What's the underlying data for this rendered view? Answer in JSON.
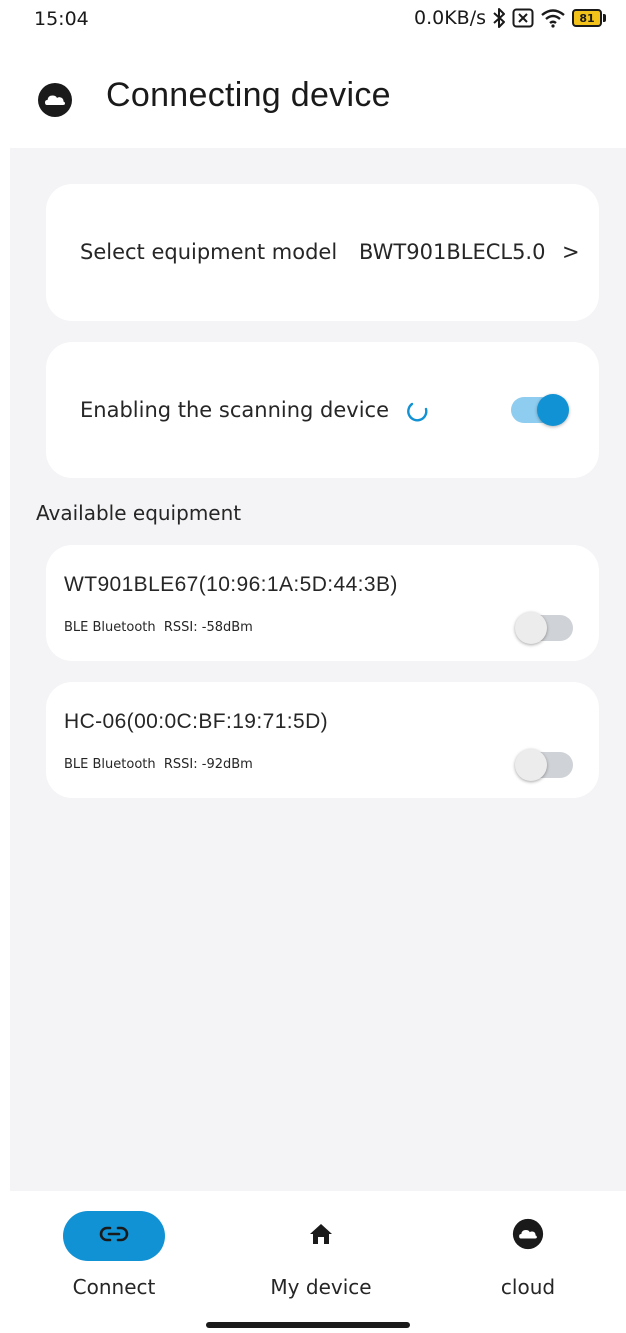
{
  "status_bar": {
    "time": "15:04",
    "network_speed": "0.0KB/s",
    "battery_level": "81",
    "icons": [
      "bluetooth-icon",
      "sim-blocked-icon",
      "wifi-icon",
      "battery-icon"
    ]
  },
  "header": {
    "title": "Connecting device",
    "icon": "cloud-icon"
  },
  "model_card": {
    "label": "Select equipment model",
    "value": "BWT901BLECL5.0",
    "chevron": ">"
  },
  "scan_card": {
    "label": "Enabling the scanning device",
    "toggle_on": true
  },
  "available": {
    "section_label": "Available equipment",
    "devices": [
      {
        "name": "WT901BLE67(10:96:1A:5D:44:3B)",
        "type": "BLE Bluetooth",
        "rssi": "RSSI: -58dBm",
        "connected": false
      },
      {
        "name": "HC-06(00:0C:BF:19:71:5D)",
        "type": "BLE Bluetooth",
        "rssi": "RSSI: -92dBm",
        "connected": false
      }
    ]
  },
  "bottom_nav": {
    "items": [
      {
        "label": "Connect",
        "icon": "link-icon",
        "active": true
      },
      {
        "label": "My device",
        "icon": "home-icon",
        "active": false
      },
      {
        "label": "cloud",
        "icon": "cloud-icon",
        "active": false
      }
    ]
  },
  "colors": {
    "accent": "#1192d4",
    "accent_light": "#8ecdf0",
    "background": "#f4f4f6",
    "card": "#ffffff"
  }
}
